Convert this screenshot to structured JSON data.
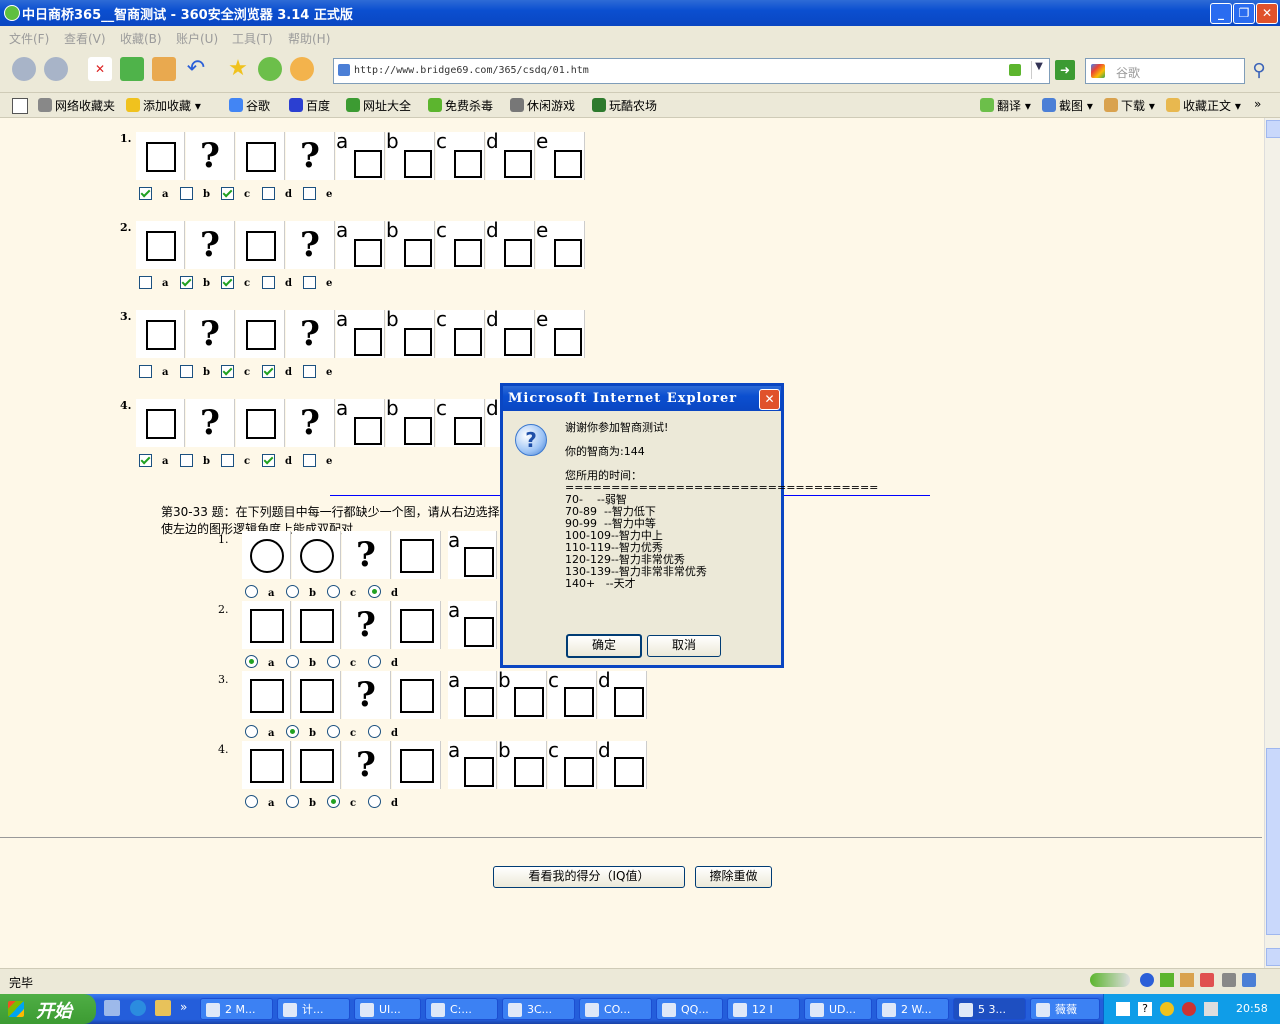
{
  "window": {
    "title": "中日商桥365__智商测试 - 360安全浏览器 3.14 正式版"
  },
  "menu": [
    "文件(F)",
    "查看(V)",
    "收藏(B)",
    "账户(U)",
    "工具(T)",
    "帮助(H)"
  ],
  "address": {
    "url": "http://www.bridge69.com/365/csdq/01.htm"
  },
  "search": {
    "placeholder": "谷歌"
  },
  "favorites": [
    "网络收藏夹",
    "添加收藏",
    "谷歌",
    "百度",
    "网址大全",
    "免费杀毒",
    "休闲游戏",
    "玩酷农场"
  ],
  "favorites_right": [
    "翻译",
    "截图",
    "下载",
    "收藏正文"
  ],
  "section1": {
    "questions": [
      {
        "num": "1.",
        "options": [
          "a",
          "b",
          "c",
          "d",
          "e"
        ],
        "checked": [
          "a",
          "c"
        ]
      },
      {
        "num": "2.",
        "options": [
          "a",
          "b",
          "c",
          "d",
          "e"
        ],
        "checked": [
          "b",
          "c"
        ]
      },
      {
        "num": "3.",
        "options": [
          "a",
          "b",
          "c",
          "d",
          "e"
        ],
        "checked": [
          "c",
          "d"
        ]
      },
      {
        "num": "4.",
        "options": [
          "a",
          "b",
          "c",
          "d",
          "e"
        ],
        "checked": [
          "a",
          "d"
        ]
      }
    ]
  },
  "section2": {
    "instruction_line1": "第30-33 题：在下列题目中每一行都缺少一个图，请从右边选择",
    "instruction_line2": "使左边的图形逻辑角度上能成双配对",
    "questions": [
      {
        "num": "1.",
        "options": [
          "a",
          "b",
          "c",
          "d"
        ],
        "selected": "d"
      },
      {
        "num": "2.",
        "options": [
          "a",
          "b",
          "c",
          "d"
        ],
        "selected": "a"
      },
      {
        "num": "3.",
        "options": [
          "a",
          "b",
          "c",
          "d"
        ],
        "selected": "b"
      },
      {
        "num": "4.",
        "options": [
          "a",
          "b",
          "c",
          "d"
        ],
        "selected": "c"
      }
    ]
  },
  "buttons": {
    "score": "看看我的得分（IQ值）",
    "reset": "擦除重做"
  },
  "dialog": {
    "title": "Microsoft Internet Explorer",
    "message": "谢谢你参加智商测试!\n\n你的智商为:144\n\n您所用的时间：\n==================================\n70-    --弱智\n70-89  --智力低下\n90-99  --智力中等\n100-109--智力中上\n110-119--智力优秀\n120-129--智力非常优秀\n130-139--智力非常非常优秀\n140+   --天才",
    "ok": "确定",
    "cancel": "取消"
  },
  "status": {
    "text": "完毕"
  },
  "taskbar": {
    "start": "开始",
    "tasks": [
      "2 M...",
      "计...",
      "UI...",
      "C:...",
      "3C...",
      "CO...",
      "QQ...",
      "12 I",
      "UD...",
      "2 W...",
      "5 3...",
      "薇薇"
    ],
    "time": "20:58"
  }
}
